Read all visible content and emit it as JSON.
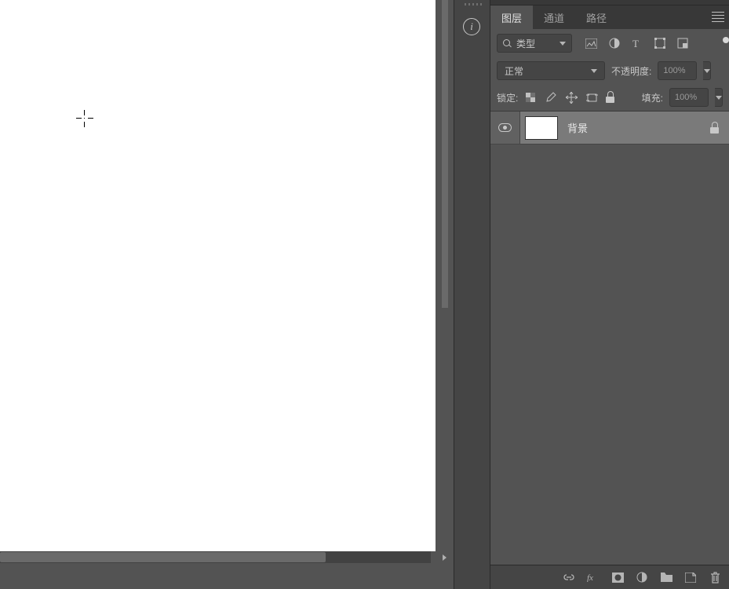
{
  "tabs": {
    "layers": "图层",
    "channels": "通道",
    "paths": "路径"
  },
  "filter": {
    "label": "类型"
  },
  "blend": {
    "mode": "正常",
    "opacity_label": "不透明度:",
    "opacity_value": "100%"
  },
  "lock": {
    "label": "锁定:",
    "fill_label": "填充:",
    "fill_value": "100%"
  },
  "layer": {
    "name": "背景"
  }
}
